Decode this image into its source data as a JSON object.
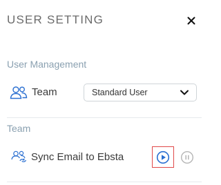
{
  "header": {
    "title": "USER SETTING",
    "close_icon": "close-icon"
  },
  "user_management": {
    "section_label": "User Management",
    "team": {
      "icon": "users-icon",
      "label": "Team",
      "select_value": "Standard User",
      "chevron_icon": "chevron-down-icon"
    }
  },
  "team_section": {
    "section_label": "Team",
    "sync": {
      "icon": "users-sync-icon",
      "label": "Sync Email to Ebsta",
      "play_icon": "play-circle-icon",
      "pause_icon": "pause-circle-icon"
    }
  },
  "colors": {
    "accent_blue": "#2a6fd1",
    "highlight_red": "#e04848",
    "muted_gray": "#b5b5b5"
  }
}
